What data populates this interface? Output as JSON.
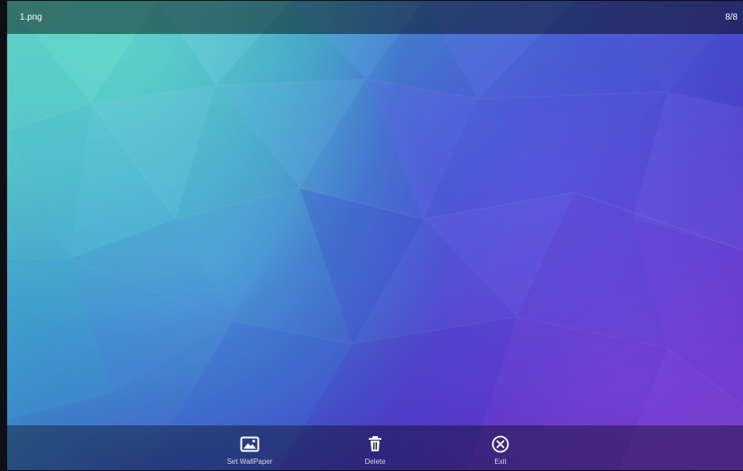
{
  "viewer": {
    "filename": "1.png",
    "counter": "8/8"
  },
  "actions": [
    {
      "label": "Set WallPaper",
      "icon": "image-icon"
    },
    {
      "label": "Delete",
      "icon": "trash-icon"
    },
    {
      "label": "Exit",
      "icon": "close-circle-icon"
    }
  ],
  "colors": {
    "top_bar": "#000000",
    "bottom_bar": "#000000",
    "accent_teal": "#5ed0c5",
    "accent_blue": "#3d5bc8",
    "accent_purple": "#6d35c8",
    "text": "#ffffff"
  }
}
